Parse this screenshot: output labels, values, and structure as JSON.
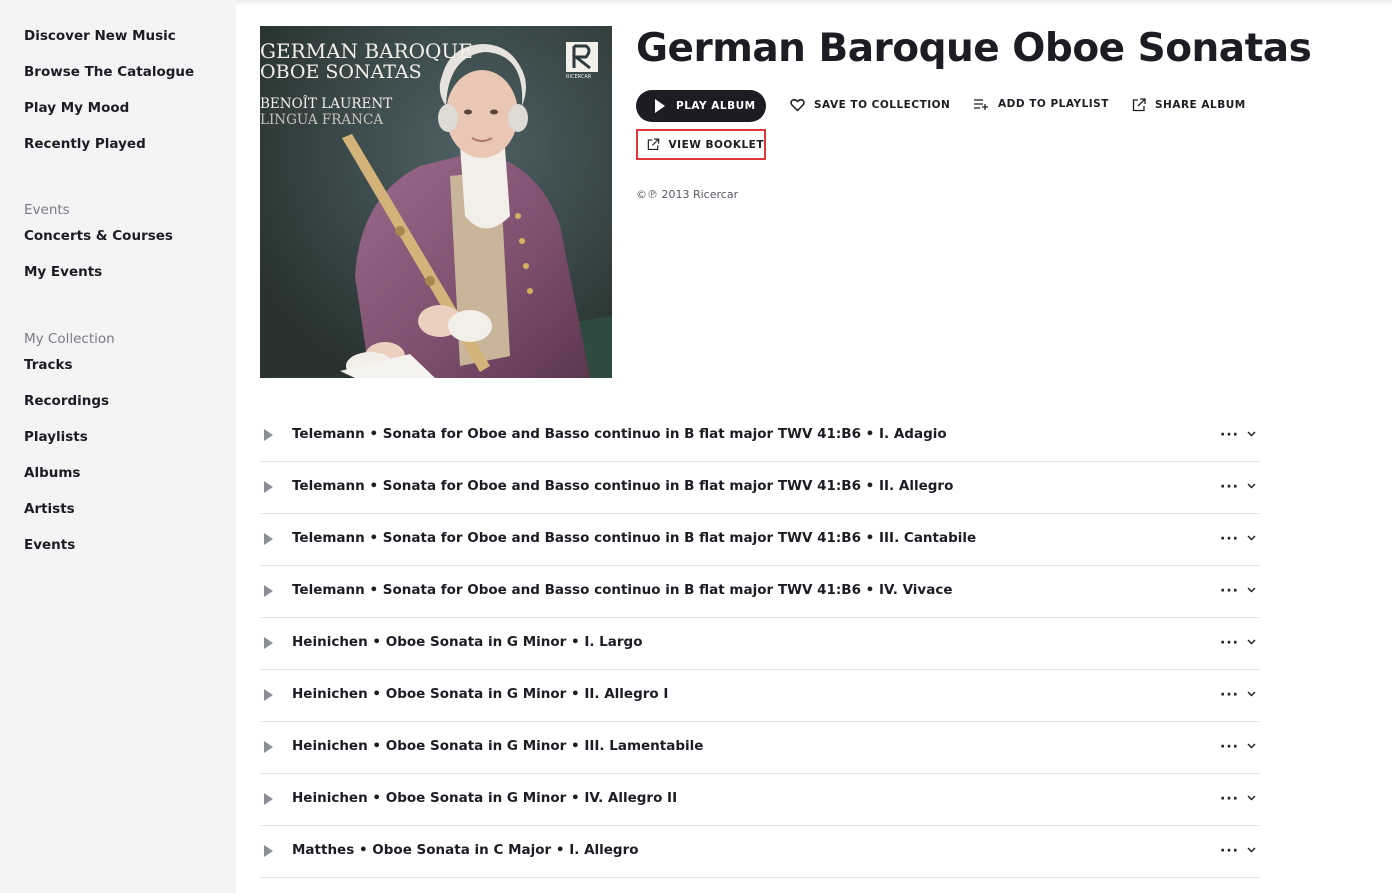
{
  "sidebar": {
    "main_items": [
      {
        "label": "Discover New Music"
      },
      {
        "label": "Browse The Catalogue"
      },
      {
        "label": "Play My Mood"
      },
      {
        "label": "Recently Played"
      }
    ],
    "events_heading": "Events",
    "events_items": [
      {
        "label": "Concerts & Courses"
      },
      {
        "label": "My Events"
      }
    ],
    "collection_heading": "My Collection",
    "collection_items": [
      {
        "label": "Tracks"
      },
      {
        "label": "Recordings"
      },
      {
        "label": "Playlists"
      },
      {
        "label": "Albums"
      },
      {
        "label": "Artists"
      },
      {
        "label": "Events"
      }
    ]
  },
  "album": {
    "title": "German Baroque Oboe Sonatas",
    "cover": {
      "line1": "GERMAN BAROQUE",
      "line2": "OBOE SONATAS",
      "artist1": "BENOÎT LAURENT",
      "artist2": "LINGUA FRANCA",
      "label_logo": "RICERCAR"
    },
    "copyright": "©℗ 2013 Ricercar"
  },
  "actions": {
    "play": "PLAY ALBUM",
    "save": "SAVE TO COLLECTION",
    "add_playlist": "ADD TO PLAYLIST",
    "share": "SHARE ALBUM",
    "booklet": "VIEW BOOKLET"
  },
  "colors": {
    "accent_dark": "#1c1c24",
    "highlight_border": "#e0373a",
    "sidebar_bg": "#f4f4f5"
  },
  "tracks": [
    {
      "title": "Telemann • Sonata for Oboe and Basso continuo in B flat major TWV 41:B6 • I. Adagio"
    },
    {
      "title": "Telemann • Sonata for Oboe and Basso continuo in B flat major TWV 41:B6 • II. Allegro"
    },
    {
      "title": "Telemann • Sonata for Oboe and Basso continuo in B flat major TWV 41:B6 • III. Cantabile"
    },
    {
      "title": "Telemann • Sonata for Oboe and Basso continuo in B flat major TWV 41:B6 • IV. Vivace"
    },
    {
      "title": "Heinichen • Oboe Sonata in G Minor • I. Largo"
    },
    {
      "title": "Heinichen • Oboe Sonata in G Minor • II. Allegro I"
    },
    {
      "title": "Heinichen • Oboe Sonata in G Minor • III. Lamentabile"
    },
    {
      "title": "Heinichen • Oboe Sonata in G Minor • IV. Allegro II"
    },
    {
      "title": "Matthes • Oboe Sonata in C Major • I. Allegro"
    }
  ],
  "track_more_glyph": "···"
}
